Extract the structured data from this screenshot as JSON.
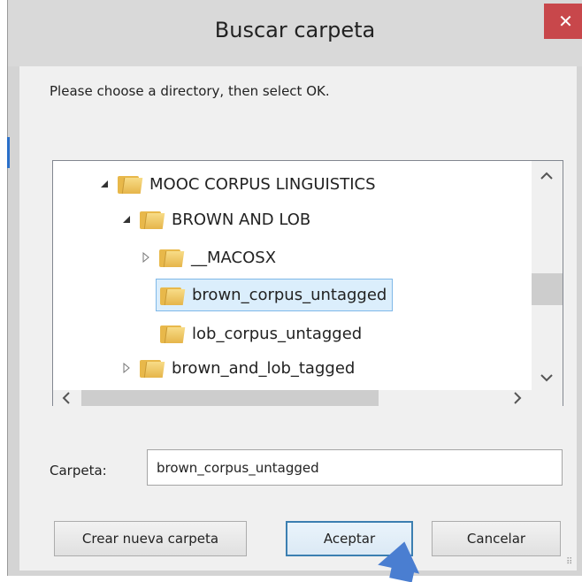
{
  "dialog": {
    "title": "Buscar carpeta",
    "close_label": "✕",
    "instruction": "Please choose a directory, then select OK."
  },
  "tree": {
    "items": [
      {
        "label": "MOOC CORPUS LINGUISTICS",
        "expander": "expanded",
        "selected": false
      },
      {
        "label": "BROWN AND LOB",
        "expander": "expanded",
        "selected": false
      },
      {
        "label": "__MACOSX",
        "expander": "collapsed",
        "selected": false
      },
      {
        "label": "brown_corpus_untagged",
        "expander": "none",
        "selected": true
      },
      {
        "label": "lob_corpus_untagged",
        "expander": "none",
        "selected": false
      },
      {
        "label": "brown_and_lob_tagged",
        "expander": "collapsed",
        "selected": false
      }
    ],
    "scroll_up_icon": "chevron-up-icon",
    "scroll_down_icon": "chevron-down-icon",
    "scroll_left_icon": "chevron-left-icon",
    "scroll_right_icon": "chevron-right-icon"
  },
  "folder_field": {
    "label": "Carpeta:",
    "value": "brown_corpus_untagged"
  },
  "buttons": {
    "new_folder": "Crear nueva carpeta",
    "ok": "Aceptar",
    "cancel": "Cancelar"
  },
  "colors": {
    "close_bg": "#c8474b",
    "selection_bg": "#dbeefc",
    "selection_border": "#7fb8e8",
    "default_button_border": "#3c7fb1",
    "pointer": "#4a7ed1"
  }
}
